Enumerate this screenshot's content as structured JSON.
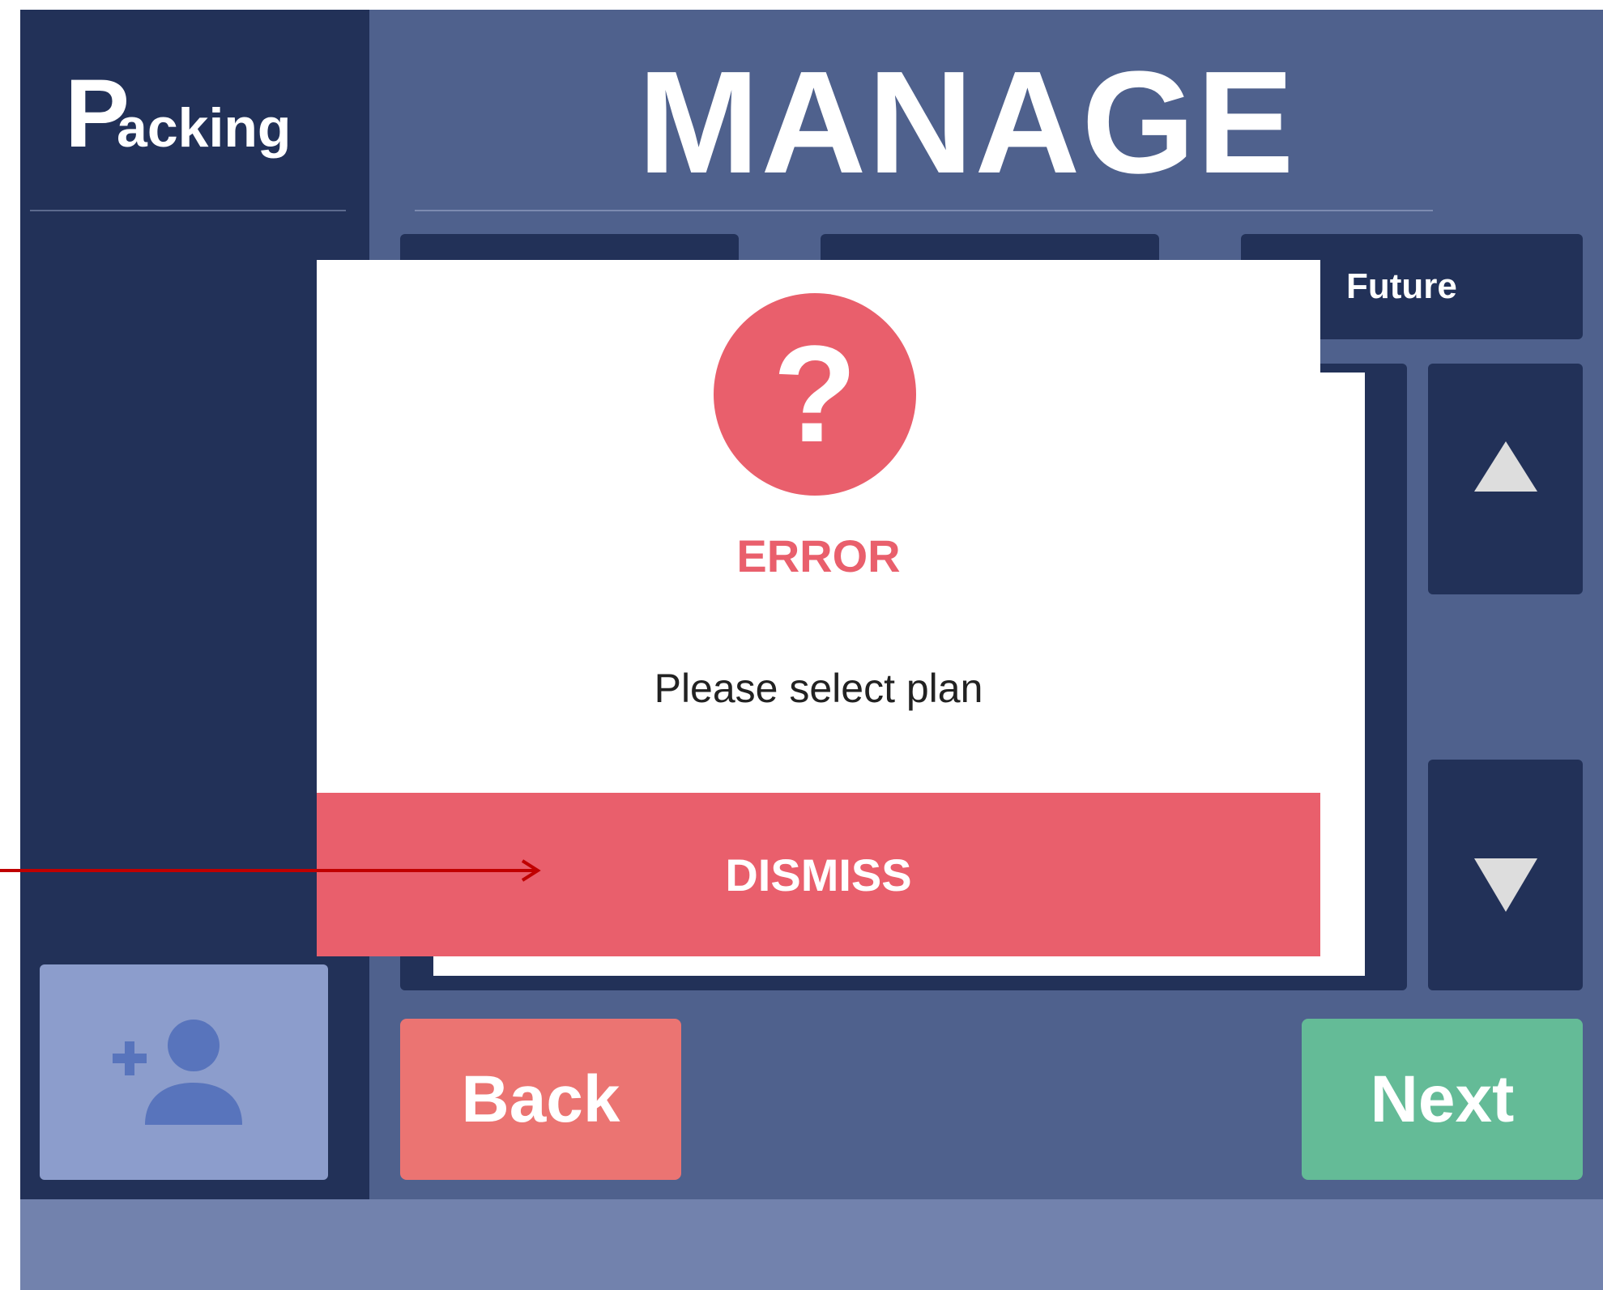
{
  "sidebar": {
    "logo_initial": "P",
    "logo_rest": "acking",
    "add_user_icon": "add-person-icon"
  },
  "header": {
    "title": "MANAGE"
  },
  "tabs": [
    {
      "label": ""
    },
    {
      "label": ""
    },
    {
      "label": "Future"
    }
  ],
  "scroll": {
    "up_icon": "triangle-up-icon",
    "down_icon": "triangle-down-icon"
  },
  "footer_buttons": {
    "back_label": "Back",
    "next_label": "Next"
  },
  "modal": {
    "icon": "question-mark-icon",
    "icon_glyph": "?",
    "title": "ERROR",
    "message": "Please select plan",
    "dismiss_label": "DISMISS"
  },
  "colors": {
    "background": "#4f618d",
    "sidebar": "#223158",
    "error_red": "#e95f6c",
    "back_button": "#eb7472",
    "next_button": "#64bb97",
    "add_user_button": "#8c9dcc",
    "footer_bar": "#7282ad",
    "annotation_arrow": "#c00000"
  }
}
